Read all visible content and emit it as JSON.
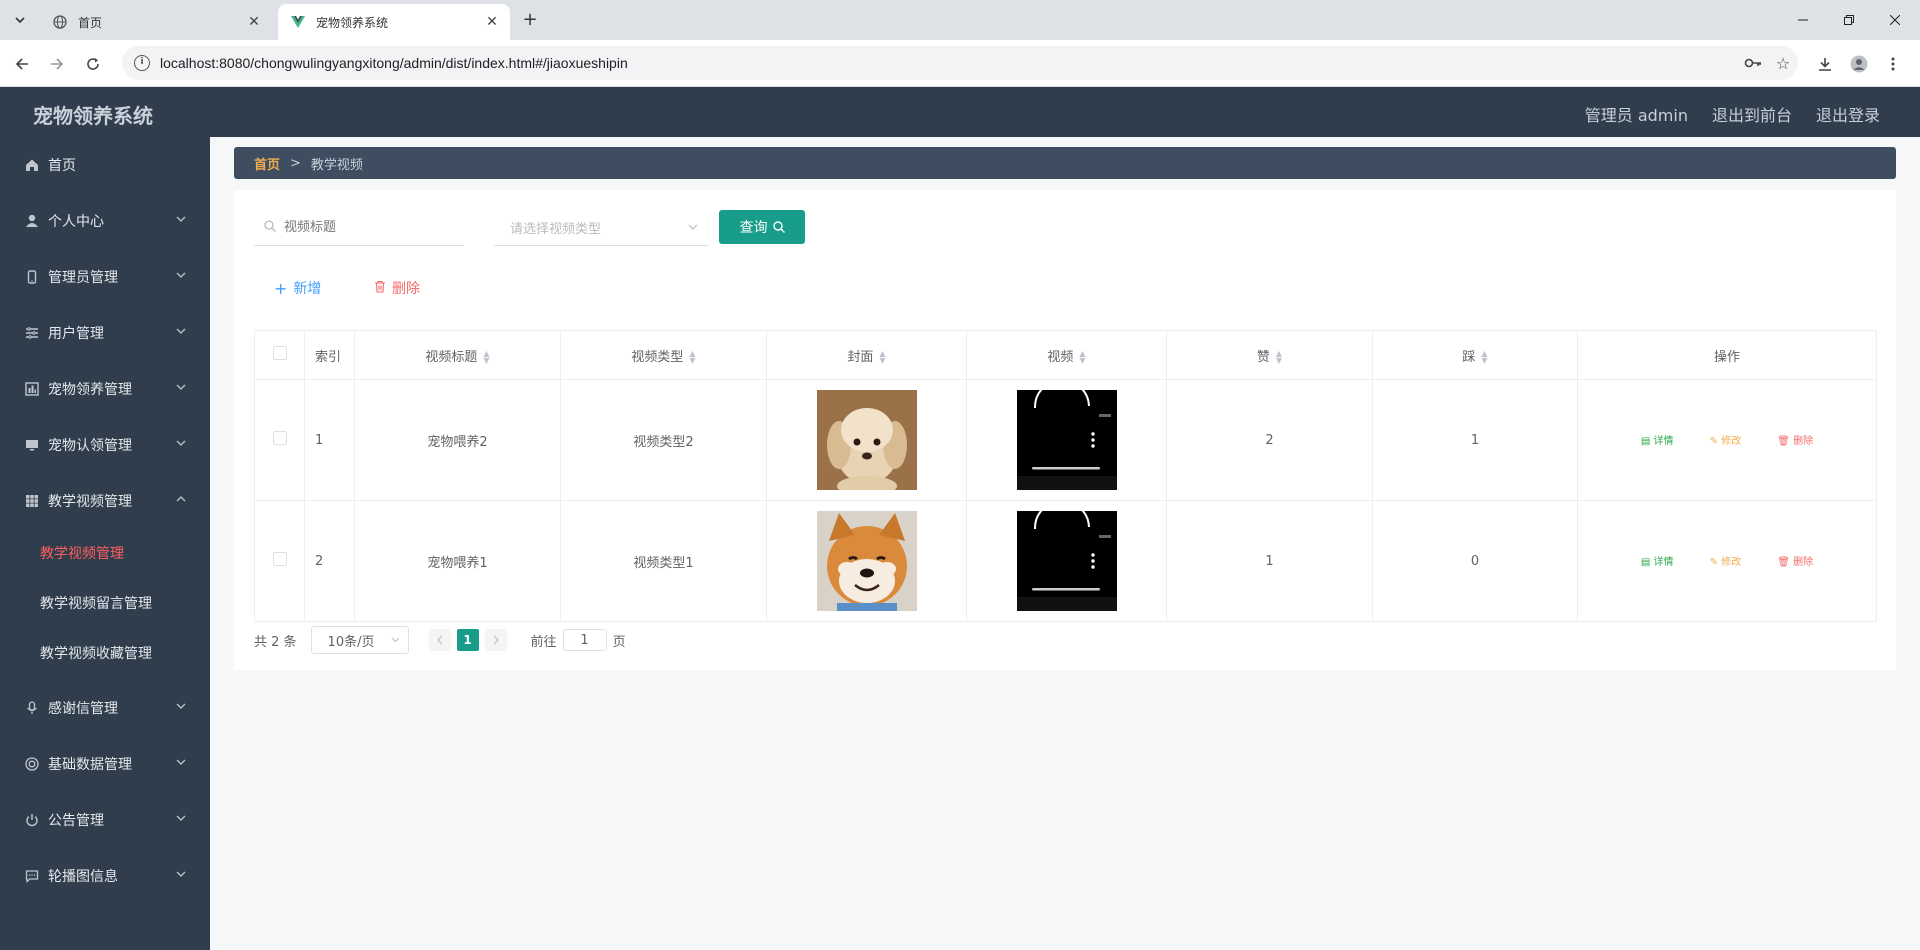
{
  "browser": {
    "tabs": [
      {
        "title": "首页",
        "active": false
      },
      {
        "title": "宠物领养系统",
        "active": true
      }
    ],
    "url": "localhost:8080/chongwulingyangxitong/admin/dist/index.html#/jiaoxueshipin"
  },
  "header": {
    "title": "宠物领养系统",
    "user": "管理员 admin",
    "front": "退出到前台",
    "logout": "退出登录"
  },
  "sidebar": {
    "items": [
      {
        "label": "首页",
        "icon": "home-icon"
      },
      {
        "label": "个人中心",
        "icon": "user-icon"
      },
      {
        "label": "管理员管理",
        "icon": "phone-icon"
      },
      {
        "label": "用户管理",
        "icon": "list-icon"
      },
      {
        "label": "宠物领养管理",
        "icon": "chart-icon"
      },
      {
        "label": "宠物认领管理",
        "icon": "monitor-icon"
      },
      {
        "label": "教学视频管理",
        "icon": "grid-icon"
      },
      {
        "label": "感谢信管理",
        "icon": "mic-icon"
      },
      {
        "label": "基础数据管理",
        "icon": "support-icon"
      },
      {
        "label": "公告管理",
        "icon": "power-icon"
      },
      {
        "label": "轮播图信息",
        "icon": "chat-icon"
      }
    ],
    "sub": [
      {
        "label": "教学视频管理",
        "active": true
      },
      {
        "label": "教学视频留言管理",
        "active": false
      },
      {
        "label": "教学视频收藏管理",
        "active": false
      }
    ]
  },
  "breadcrumb": {
    "home": "首页",
    "sep": ">",
    "current": "教学视频"
  },
  "search": {
    "title_placeholder": "视频标题",
    "type_placeholder": "请选择视频类型",
    "query": "查询"
  },
  "actions": {
    "add": "新增",
    "delete": "删除"
  },
  "table": {
    "headers": [
      "索引",
      "视频标题",
      "视频类型",
      "封面",
      "视频",
      "赞",
      "踩",
      "操作"
    ],
    "rows": [
      {
        "index": "1",
        "title": "宠物喂养2",
        "type": "视频类型2",
        "cover": "puppy",
        "likes": "2",
        "dislikes": "1"
      },
      {
        "index": "2",
        "title": "宠物喂养1",
        "type": "视频类型1",
        "cover": "shiba",
        "likes": "1",
        "dislikes": "0"
      }
    ],
    "ops": {
      "detail": "详情",
      "edit": "修改",
      "delete": "删除"
    }
  },
  "pager": {
    "total": "共 2 条",
    "size": "10条/页",
    "current": "1",
    "goto_prefix": "前往",
    "goto_value": "1",
    "goto_suffix": "页"
  },
  "colors": {
    "accent": "#179d89",
    "header": "#2f3d4c",
    "active_menu": "#ff5f5f"
  }
}
